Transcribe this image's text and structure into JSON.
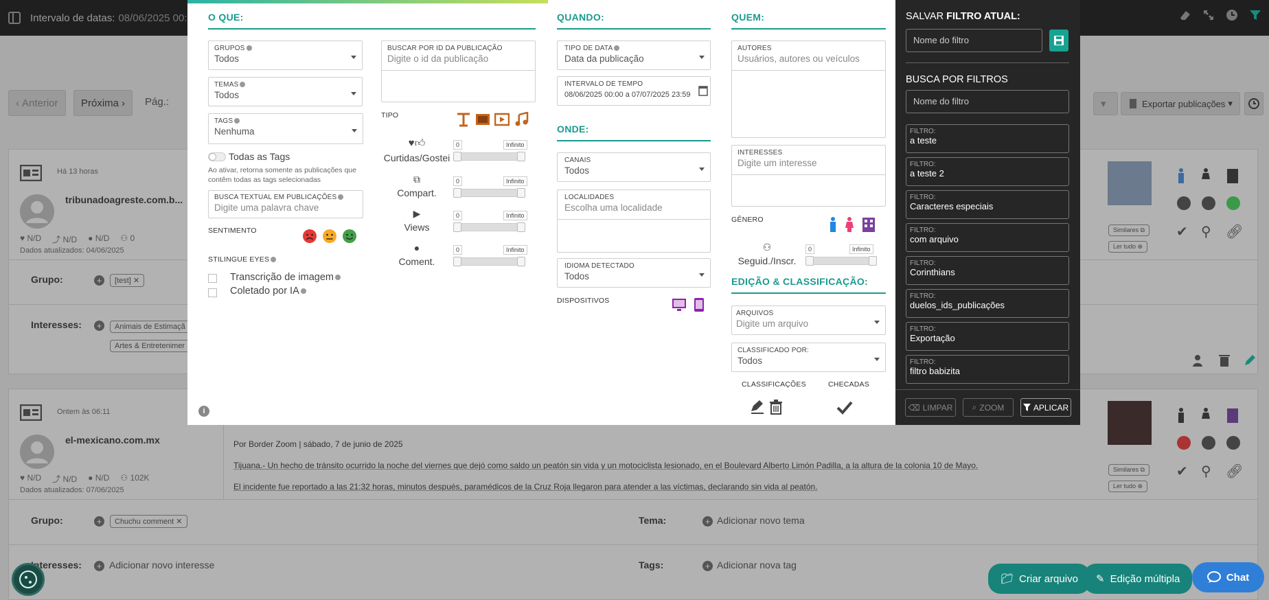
{
  "topbar": {
    "date_label": "Intervalo de datas:",
    "date_value": "08/06/2025 00:0"
  },
  "pager": {
    "prev": "Anterior",
    "next": "Próxima",
    "page_label": "Pág.:",
    "export": "Exportar publicações"
  },
  "posts": [
    {
      "time": "Há 13 horas",
      "source": "tribunadoagreste.com.b...",
      "likes": "N/D",
      "shares": "N/D",
      "comments": "N/D",
      "followers": "0",
      "updated": "Dados atualizados: 04/06/2025",
      "group_label": "Grupo:",
      "group_chip": "[test]",
      "interests_label": "Interesses:",
      "interest_chips": [
        "Animais de Estimaçã",
        "Artes & Entretenimer"
      ],
      "similar": "Similares",
      "read_all": "Ler tudo"
    },
    {
      "time": "Ontem às 06:11",
      "source": "el-mexicano.com.mx",
      "likes": "N/D",
      "shares": "N/D",
      "comments": "N/D",
      "followers": "102K",
      "updated": "Dados atualizados: 07/06/2025",
      "group_label": "Grupo:",
      "group_chip": "Chuchu comment",
      "interests_label": "Interesses:",
      "add_interest": "Adicionar novo interesse",
      "theme_label": "Tema:",
      "add_theme": "Adicionar novo tema",
      "tags_label": "Tags:",
      "add_tag": "Adicionar nova tag",
      "similar": "Similares",
      "read_all": "Ler tudo",
      "body": [
        "Por Border Zoom | sábado, 7 de junio de 2025",
        "Tijuana.- Un hecho de tránsito ocurrido la noche del viernes que dejó como saldo un peatón sin vida y un motociclista lesionado, en el Boulevard Alberto Limón Padilla, a la altura de la colonia 10 de Mayo.",
        "El incidente fue reportado a las 21:32 horas, minutos después, paramédicos de la Cruz Roja llegaron para atender a las víctimas, declarando sin vida al peatón."
      ]
    }
  ],
  "bottom": {
    "create_file": "Criar arquivo",
    "multi_edit": "Edição múltipla",
    "chat": "Chat"
  },
  "modal": {
    "what": {
      "title": "O QUE:",
      "groups_label": "GRUPOS",
      "groups_value": "Todos",
      "themes_label": "TEMAS",
      "themes_value": "Todos",
      "tags_label": "TAGS",
      "tags_value": "Nenhuma",
      "all_tags_label": "Todas as Tags",
      "all_tags_help": "Ao ativar, retorna somente as publicações que contêm todas as tags selecionadas",
      "text_search_label": "BUSCA TEXTUAL EM PUBLICAÇÕES",
      "text_search_placeholder": "Digite uma palavra chave",
      "sentiment_label": "SENTIMENTO",
      "eyes_label": "STILINGUE EYES",
      "eyes_options": [
        "Transcrição de imagem",
        "Coletado por IA"
      ],
      "id_search_label": "BUSCAR POR ID DA PUBLICAÇÃO",
      "id_search_placeholder": "Digite o id da publicação",
      "type_label": "TIPO",
      "metrics": [
        {
          "label": "Curtidas/Gostei",
          "min": "0",
          "max": "Infinito"
        },
        {
          "label": "Compart.",
          "min": "0",
          "max": "Infinito"
        },
        {
          "label": "Views",
          "min": "0",
          "max": "Infinito"
        },
        {
          "label": "Coment.",
          "min": "0",
          "max": "Infinito"
        }
      ]
    },
    "when": {
      "title": "QUANDO:",
      "date_type_label": "TIPO DE DATA",
      "date_type_value": "Data da publicação",
      "interval_label": "INTERVALO DE TEMPO",
      "interval_value": "08/06/2025 00:00 a 07/07/2025 23:59"
    },
    "where": {
      "title": "ONDE:",
      "channels_label": "CANAIS",
      "channels_value": "Todos",
      "locations_label": "LOCALIDADES",
      "locations_placeholder": "Escolha uma localidade",
      "language_label": "IDIOMA DETECTADO",
      "language_value": "Todos",
      "devices_label": "DISPOSITIVOS"
    },
    "who": {
      "title": "QUEM:",
      "authors_label": "AUTORES",
      "authors_placeholder": "Usuários, autores ou veículos",
      "interests_label": "INTERESSES",
      "interests_placeholder": "Digite um interesse",
      "gender_label": "GÊNERO",
      "followers_label": "Seguid./Inscr.",
      "followers_min": "0",
      "followers_max": "Infinito"
    },
    "edit": {
      "title": "EDIÇÃO & CLASSIFICAÇÃO:",
      "files_label": "ARQUIVOS",
      "files_placeholder": "Digite um arquivo",
      "classified_label": "CLASSIFICADO POR:",
      "classified_value": "Todos",
      "classifications_label": "CLASSIFICAÇÕES",
      "checked_label": "CHECADAS"
    }
  },
  "side": {
    "save_prefix": "SALVAR ",
    "save_bold": "FILTRO ATUAL:",
    "save_placeholder": "Nome do filtro",
    "search_title": "BUSCA POR FILTROS",
    "search_placeholder": "Nome do filtro",
    "filter_prefix": "FILTRO:",
    "filters": [
      "a teste",
      "a teste 2",
      "Caracteres especiais",
      "com arquivo",
      "Corinthians",
      "duelos_ids_publicações",
      "Exportação",
      "filtro babizita"
    ],
    "clear": "LIMPAR",
    "zoom": "ZOOM",
    "apply": "APLICAR"
  }
}
